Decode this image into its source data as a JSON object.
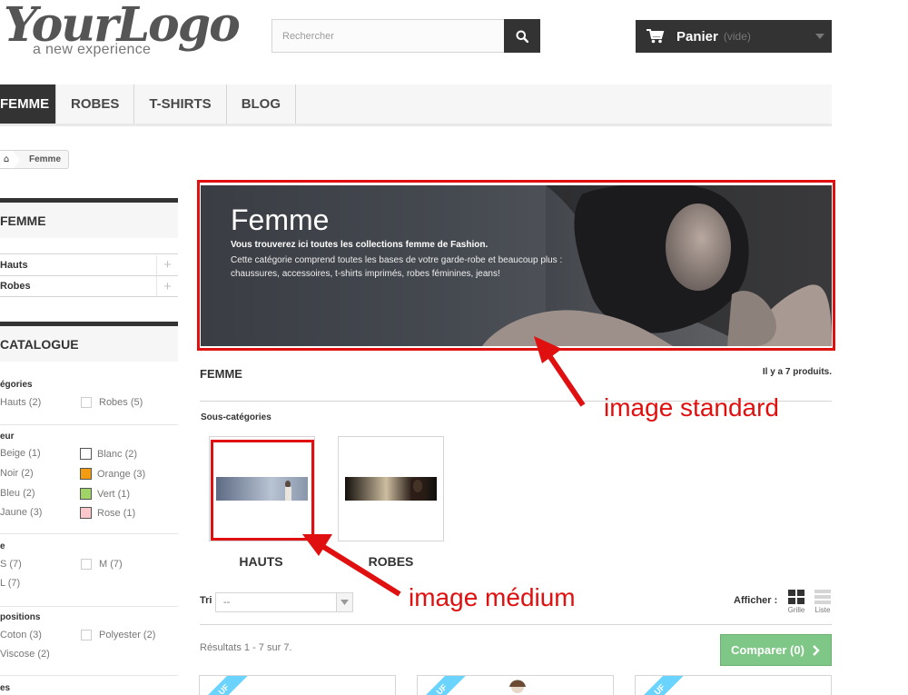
{
  "header": {
    "logo_main": "YourLogo",
    "logo_sub": "a new experience",
    "search_placeholder": "Rechercher",
    "cart_label": "Panier",
    "cart_empty": "(vide)"
  },
  "nav": {
    "items": [
      {
        "label": "FEMME",
        "active": true
      },
      {
        "label": "ROBES",
        "active": false
      },
      {
        "label": "T-SHIRTS",
        "active": false
      },
      {
        "label": "BLOG",
        "active": false
      }
    ]
  },
  "breadcrumb": {
    "current": "Femme"
  },
  "sidebar": {
    "category_title": "FEMME",
    "categories": [
      {
        "label": "Hauts"
      },
      {
        "label": "Robes"
      }
    ],
    "catalogue_title": "CATALOGUE",
    "filters": {
      "categories_head": "égories",
      "categories": [
        {
          "label": "Hauts (2)"
        },
        {
          "label": "Robes (5)"
        }
      ],
      "color_head": "eur",
      "colors_left": [
        {
          "label": "Beige (1)"
        },
        {
          "label": "Noir (2)"
        },
        {
          "label": "Bleu (2)"
        },
        {
          "label": "Jaune (3)"
        }
      ],
      "colors_right": [
        {
          "label": "Blanc (2)",
          "color": "#ffffff"
        },
        {
          "label": "Orange (3)",
          "color": "#f39c11"
        },
        {
          "label": "Vert (1)",
          "color": "#a0d468"
        },
        {
          "label": "Rose (1)",
          "color": "#fcc7ca"
        }
      ],
      "size_head": "e",
      "sizes": [
        {
          "label": "S (7)"
        },
        {
          "label": "M (7)"
        },
        {
          "label": "L (7)"
        }
      ],
      "composition_head": "positions",
      "compositions": [
        {
          "label": "Coton (3)"
        },
        {
          "label": "Polyester (2)"
        },
        {
          "label": "Viscose (2)"
        }
      ],
      "last_head": "es"
    }
  },
  "banner": {
    "title": "Femme",
    "strong": "Vous trouverez ici toutes les collections femme de Fashion.",
    "desc": "Cette catégorie comprend toutes les bases de votre garde-robe et beaucoup plus : chaussures, accessoires, t-shirts imprimés, robes féminines, jeans!"
  },
  "main": {
    "category_name": "FEMME",
    "product_count": "Il y a 7 produits.",
    "subcategories_heading": "Sous-catégories",
    "subcategories": [
      {
        "label": "HAUTS"
      },
      {
        "label": "ROBES"
      }
    ],
    "sort_label": "Tri",
    "sort_value": "--",
    "view_label": "Afficher :",
    "view_grid": "Grille",
    "view_list": "Liste",
    "results": "Résultats 1 - 7 sur 7.",
    "compare_label": "Comparer (0)",
    "new_badge": "UF"
  },
  "annotations": {
    "standard": "image standard",
    "medium": "image médium",
    "color": "#e01010"
  }
}
